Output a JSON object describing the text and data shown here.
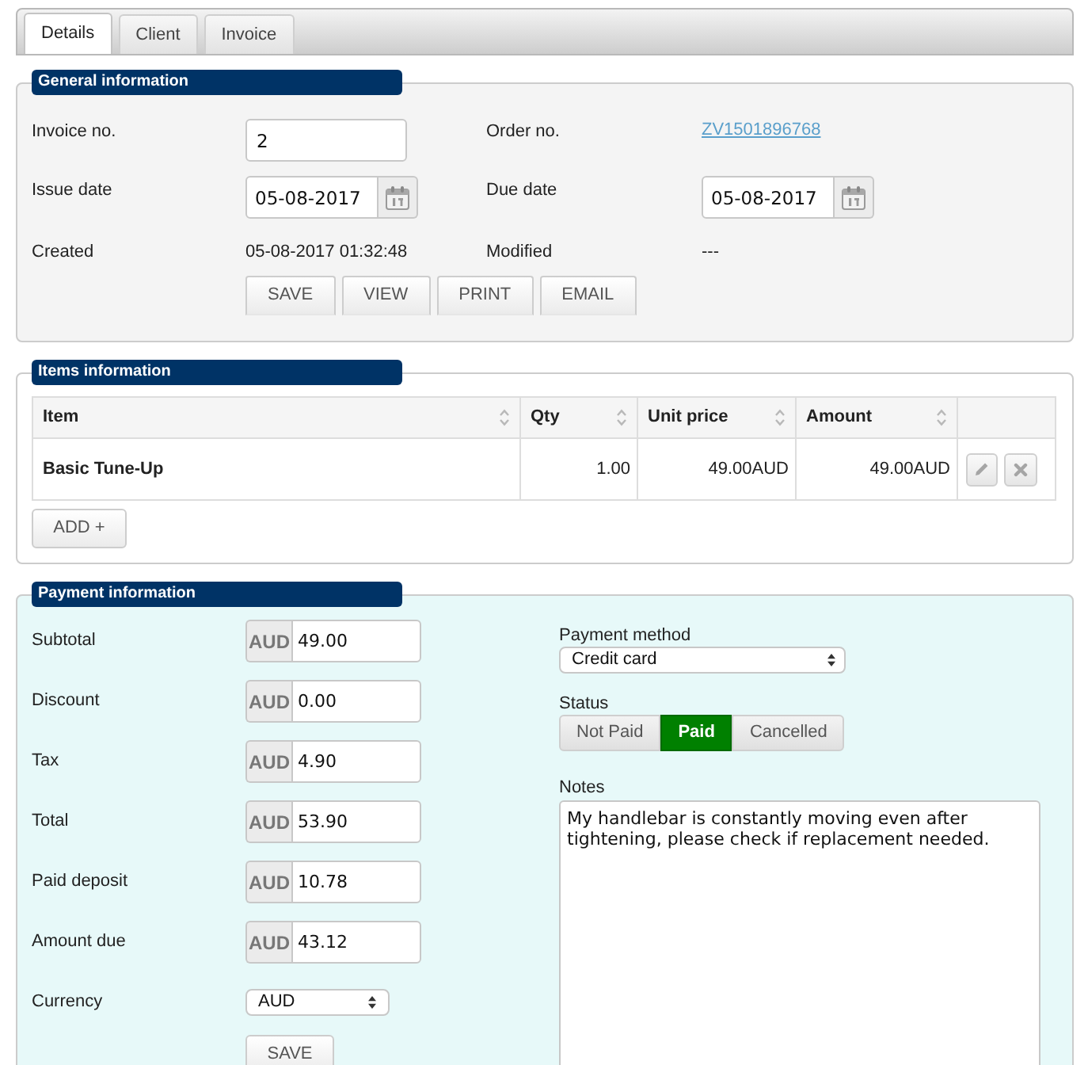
{
  "tabs": [
    {
      "label": "Details",
      "selected": true
    },
    {
      "label": "Client",
      "selected": false
    },
    {
      "label": "Invoice",
      "selected": false
    }
  ],
  "general": {
    "title": "General information",
    "fields": [
      {
        "label": "Invoice no.",
        "kind": "input",
        "value": "2"
      },
      {
        "label": "Order no.",
        "kind": "link",
        "value": "ZV1501896768"
      },
      {
        "label": "Issue date",
        "kind": "date",
        "value": "05-08-2017"
      },
      {
        "label": "Due date",
        "kind": "date",
        "value": "05-08-2017"
      },
      {
        "label": "Created",
        "kind": "text",
        "value": "05-08-2017 01:32:48"
      },
      {
        "label": "Modified",
        "kind": "text",
        "value": "---"
      }
    ],
    "buttons": [
      "SAVE",
      "VIEW",
      "PRINT",
      "EMAIL"
    ]
  },
  "items": {
    "title": "Items information",
    "columns": [
      "Item",
      "Qty",
      "Unit price",
      "Amount"
    ],
    "rows": [
      {
        "cells": [
          "Basic Tune-Up",
          "1.00",
          "49.00AUD",
          "49.00AUD"
        ]
      }
    ],
    "add_button": "ADD +"
  },
  "payment": {
    "title": "Payment information",
    "amounts": [
      {
        "label": "Subtotal",
        "currency": "AUD",
        "value": "49.00"
      },
      {
        "label": "Discount",
        "currency": "AUD",
        "value": "0.00"
      },
      {
        "label": "Tax",
        "currency": "AUD",
        "value": "4.90"
      },
      {
        "label": "Total",
        "currency": "AUD",
        "value": "53.90"
      },
      {
        "label": "Paid deposit",
        "currency": "AUD",
        "value": "10.78"
      },
      {
        "label": "Amount due",
        "currency": "AUD",
        "value": "43.12"
      }
    ],
    "currency": {
      "label": "Currency",
      "value": "AUD"
    },
    "save_button": "SAVE",
    "method": {
      "label": "Payment method",
      "value": "Credit card"
    },
    "status": {
      "label": "Status",
      "options": [
        {
          "label": "Not Paid",
          "selected": false
        },
        {
          "label": "Paid",
          "selected": true
        },
        {
          "label": "Cancelled",
          "selected": false
        }
      ]
    },
    "notes": {
      "label": "Notes",
      "value": "My handlebar is constantly moving even after tightening, please check if replacement needed."
    }
  }
}
